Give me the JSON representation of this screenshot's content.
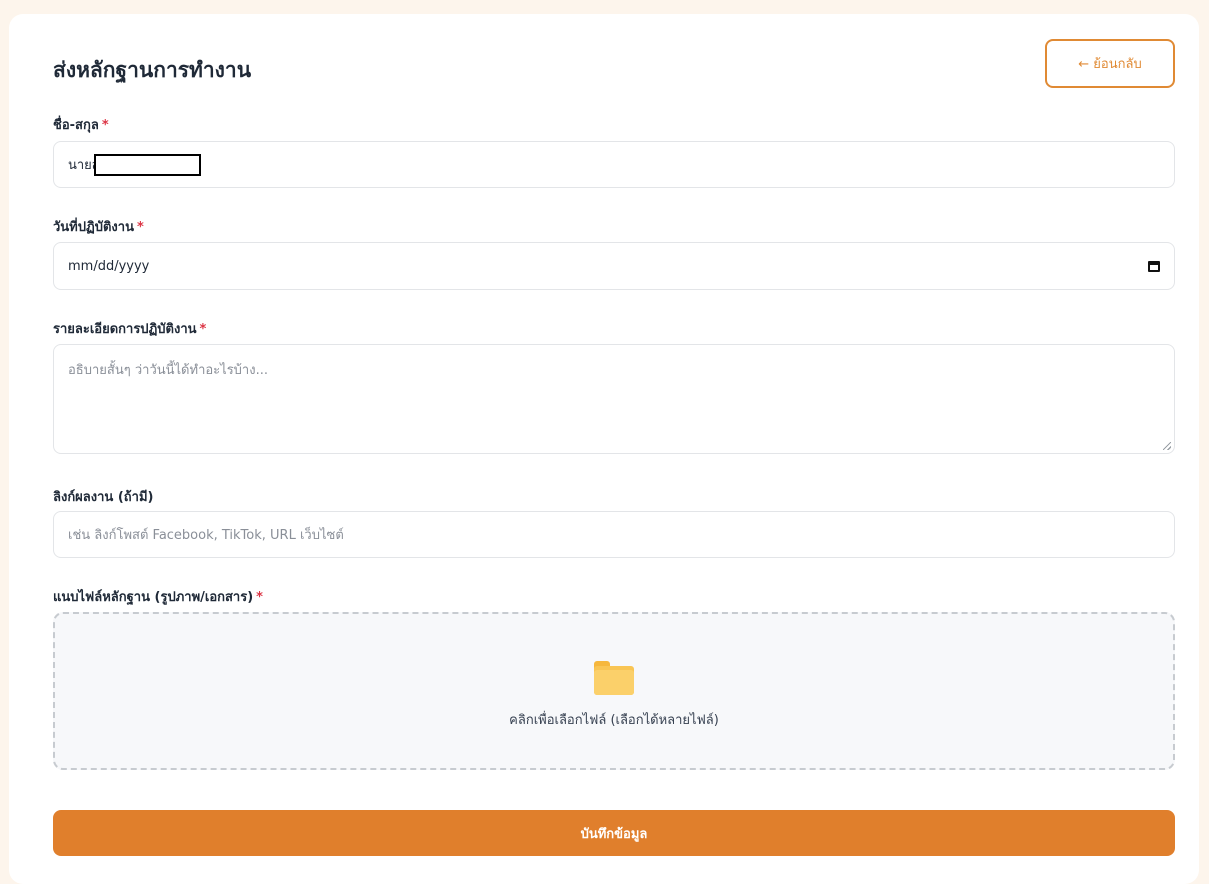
{
  "page": {
    "title": "ส่งหลักฐานการทำงาน",
    "back_label": "← ย้อนกลับ"
  },
  "form": {
    "required_mark": "*",
    "name": {
      "label": "ชื่อ-สกุล",
      "value": "นายส"
    },
    "date": {
      "label": "วันที่ปฏิบัติงาน",
      "value": "mm/dd/yyyy"
    },
    "details": {
      "label": "รายละเอียดการปฏิบัติงาน",
      "placeholder": "อธิบายสั้นๆ ว่าวันนี้ได้ทำอะไรบ้าง..."
    },
    "link": {
      "label": "ลิงก์ผลงาน (ถ้ามี)",
      "placeholder": "เช่น ลิงก์โพสต์ Facebook, TikTok, URL เว็บไซต์"
    },
    "attachment": {
      "label": "แนบไฟล์หลักฐาน (รูปภาพ/เอกสาร)",
      "dropzone_text": "คลิกเพื่อเลือกไฟล์ (เลือกได้หลายไฟล์)"
    },
    "submit_label": "บันทึกข้อมูล"
  },
  "colors": {
    "accent": "#e07f2c",
    "required": "#dc3545",
    "page_bg": "#fdf5ec"
  },
  "icons": [
    "calendar-icon",
    "folder-icon",
    "resize-grip-icon"
  ]
}
